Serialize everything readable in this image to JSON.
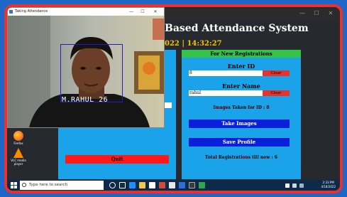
{
  "camera_window": {
    "title": "Taking Attendance",
    "face_label": "M.RAHUL  26",
    "controls": [
      "—",
      "☐",
      "✕"
    ]
  },
  "main_window": {
    "title": "Based Attendance System",
    "datetime": "022  |  14:32:27",
    "controls": [
      "—",
      "☐",
      "✕"
    ]
  },
  "left_panel": {
    "quit_label": "Quit"
  },
  "registration": {
    "header": "For New Registrations",
    "id_label": "Enter ID",
    "id_value": "8",
    "name_label": "Enter Name",
    "name_value": "rahul",
    "clear_label": "Clear",
    "images_taken": "Images Taken for ID : 8",
    "take_images_label": "Take Images",
    "save_profile_label": "Save Profile",
    "total_registrations": "Total Registrations till now  : 6"
  },
  "desktop_icons": [
    {
      "label": "Firefox",
      "color": "#ff7a1a"
    },
    {
      "label": "VLC media player",
      "color": "#ff8c00"
    }
  ],
  "taskbar": {
    "search_placeholder": "Type here to search",
    "time": "2:33 PM",
    "date": "4/18/2022"
  },
  "colors": {
    "frame_blue": "#1e66c8",
    "frame_red": "#e8322e",
    "panel_blue": "#1aa3e8",
    "header_green": "#35c24a",
    "button_blue": "#0a1fd9",
    "quit_red": "#ff1a1a",
    "datetime_yellow": "#f6c200"
  }
}
